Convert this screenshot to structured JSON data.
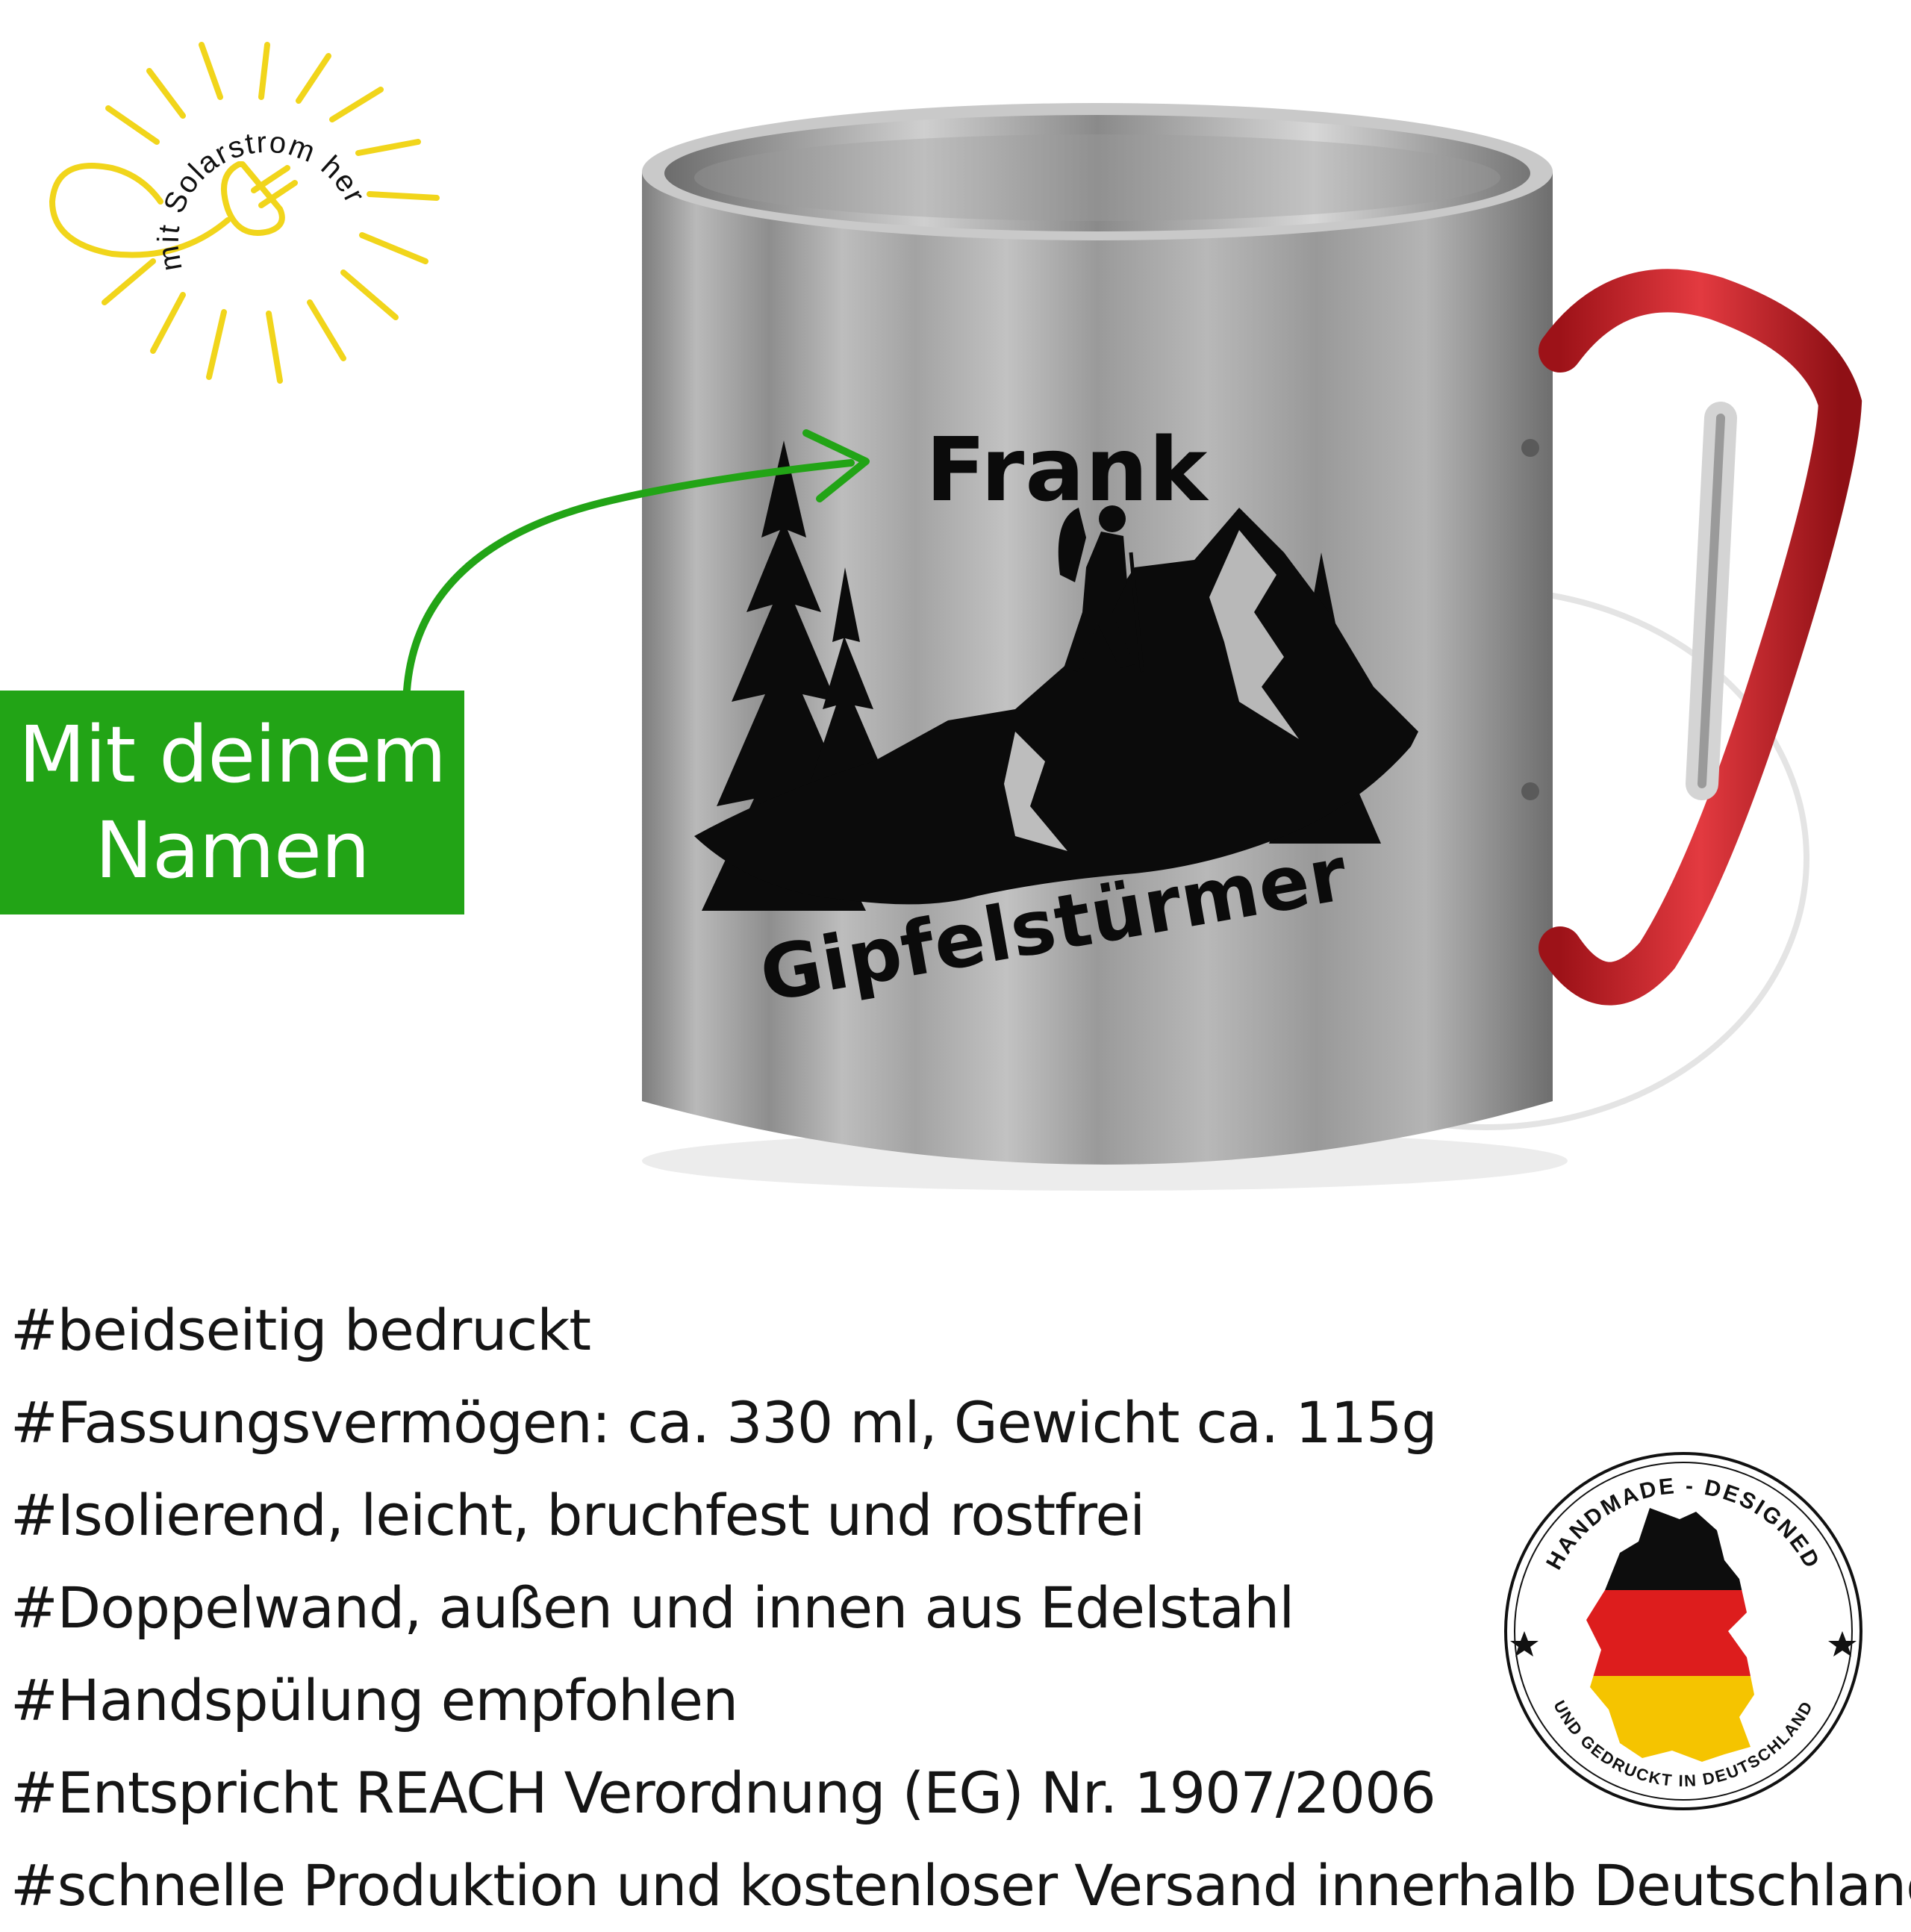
{
  "solar_badge": {
    "text": "mit Solarstrom hergestellt",
    "icon": "plug-icon",
    "color": "#f1d51b"
  },
  "mug": {
    "name": "Frank",
    "slogan": "Gipfelstürmer",
    "artwork": "hiker-mountain-icon",
    "handle": "red-carabiner-icon",
    "colors": {
      "steel": "#a6a6a6",
      "handle": "#d21f27",
      "print": "#0b0b0b"
    }
  },
  "callout": {
    "line1": "Mit deinem",
    "line2": "Namen",
    "color": "#22a416"
  },
  "features": [
    "#beidseitig bedruckt",
    "#Fassungsvermögen: ca. 330 ml, Gewicht ca. 115g",
    "#Isolierend, leicht, bruchfest und rostfrei",
    "#Doppelwand, außen und innen aus Edelstahl",
    "#Handspülung empfohlen",
    "#Entspricht REACH Verordnung (EG) Nr. 1907/2006",
    "#schnelle Produktion und kostenloser Versand innerhalb Deutschlands"
  ],
  "seal": {
    "top_text": "HANDMADE - DESIGNED",
    "bottom_text": "UND GEDRUCKT IN DEUTSCHLAND",
    "icon": "germany-flag-map-icon"
  }
}
